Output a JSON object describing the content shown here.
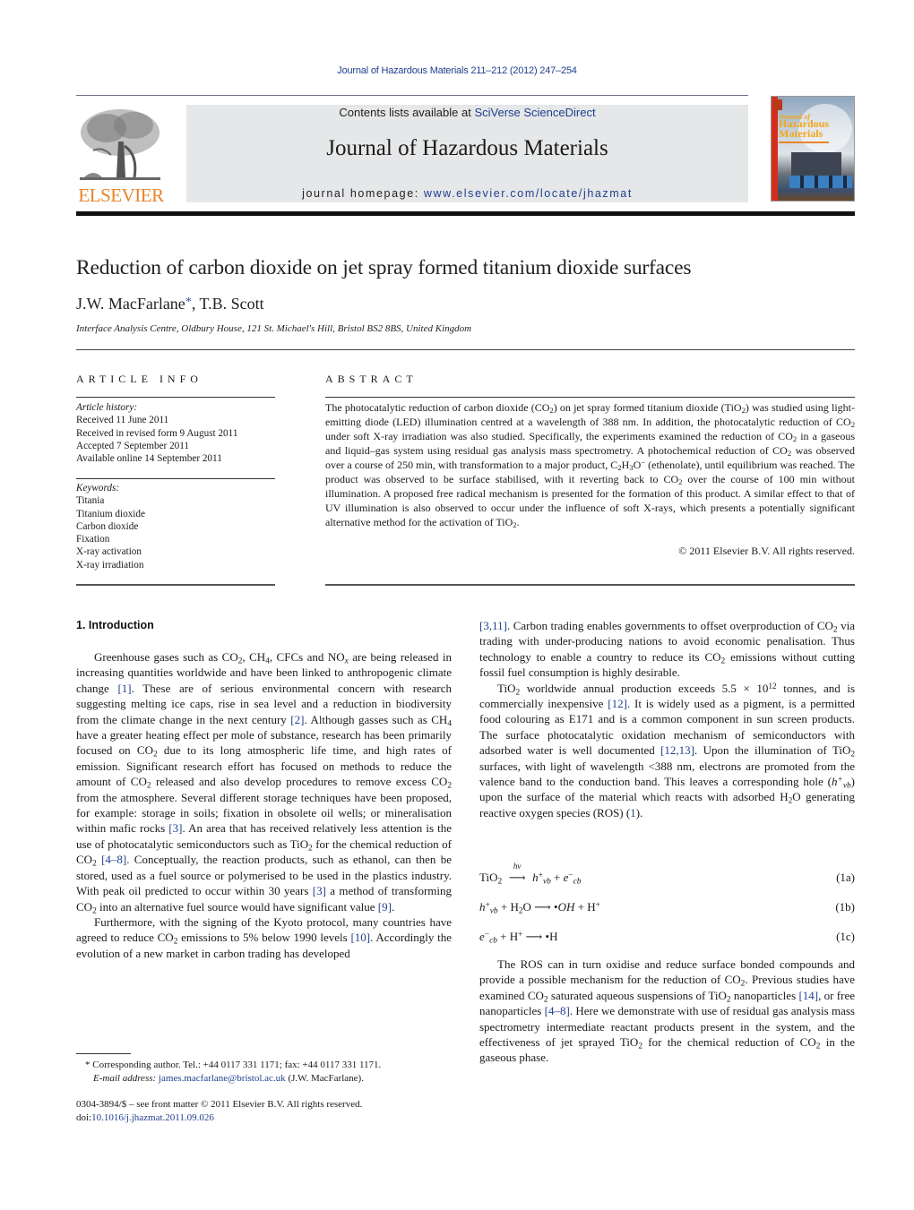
{
  "header": {
    "citation": "Journal of Hazardous Materials 211–212 (2012) 247–254",
    "contents_prefix": "Contents lists available at ",
    "contents_link": "SciVerse ScienceDirect",
    "journal_title": "Journal of Hazardous Materials",
    "homepage_prefix": "journal homepage: ",
    "homepage_link": "www.elsevier.com/locate/jhazmat",
    "publisher_wordmark": "ELSEVIER",
    "cover": {
      "line1": "Journal of",
      "line2": "Hazardous",
      "line3": "Materials"
    },
    "colors": {
      "link": "#1f3f8f",
      "elsevier_orange": "#e8842a",
      "masthead_bg": "#e6e7e8"
    }
  },
  "article": {
    "title": "Reduction of carbon dioxide on jet spray formed titanium dioxide surfaces",
    "authors": {
      "first": "J.W. MacFarlane",
      "marker": "*",
      "rest": ", T.B. Scott"
    },
    "affiliation": "Interface Analysis Centre, Oldbury House, 121 St. Michael's Hill, Bristol BS2 8BS, United Kingdom"
  },
  "article_info": {
    "heading": "ARTICLE INFO",
    "history_label": "Article history:",
    "history": [
      "Received 11 June 2011",
      "Received in revised form 9 August 2011",
      "Accepted 7 September 2011",
      "Available online 14 September 2011"
    ],
    "keywords_label": "Keywords:",
    "keywords": [
      "Titania",
      "Titanium dioxide",
      "Carbon dioxide",
      "Fixation",
      "X-ray activation",
      "X-ray irradiation"
    ]
  },
  "abstract": {
    "heading": "ABSTRACT",
    "segments": {
      "s1": "The photocatalytic reduction of carbon dioxide (CO",
      "s2": ") on jet spray formed titanium dioxide (TiO",
      "s3": ") was studied using light-emitting diode (LED) illumination centred at a wavelength of 388 nm. In addition, the photocatalytic reduction of CO",
      "s4": " under soft X-ray irradiation was also studied. Specifically, the experiments examined the reduction of CO",
      "s5": " in a gaseous and liquid–gas system using residual gas analysis mass spectrometry. A photochemical reduction of CO",
      "s6": " was observed over a course of 250 min, with transformation to a major product, C",
      "s7": "H",
      "s8": "O",
      "s9": " (ethenolate), until equilibrium was reached. The product was observed to be surface stabilised, with it reverting back to CO",
      "s10": " over the course of 100 min without illumination. A proposed free radical mechanism is presented for the formation of this product. A similar effect to that of UV illumination is also observed to occur under the influence of soft X-rays, which presents a potentially significant alternative method for the activation of TiO",
      "s11": "."
    },
    "copyright": "© 2011 Elsevier B.V. All rights reserved."
  },
  "introduction": {
    "heading": "1.  Introduction",
    "p1": {
      "a": "Greenhouse gases such as CO",
      "b": ", CH",
      "c": ", CFCs and NO",
      "d": " are being released in increasing quantities worldwide and have been linked to anthropogenic climate change ",
      "ref1": "[1]",
      "e": ". These are of serious environmental concern with research suggesting melting ice caps, rise in sea level and a reduction in biodiversity from the climate change in the next century ",
      "ref2": "[2]",
      "f": ". Although gasses such as CH",
      "g": " have a greater heating effect per mole of substance, research has been primarily focused on CO",
      "h": " due to its long atmospheric life time, and high rates of emission. Significant research effort has focused on methods to reduce the amount of CO",
      "i": " released and also develop procedures to remove excess CO",
      "j": " from the atmosphere. Several different storage techniques have been proposed, for example: storage in soils; fixation in obsolete oil wells; or mineralisation within mafic rocks ",
      "ref3": "[3]",
      "k": ". An area that has received relatively less attention is the use of photocatalytic semiconductors such as TiO",
      "l": " for the chemical reduction of CO",
      "ref4": "[4–8]",
      "m": ". Conceptually, the reaction products, such as ethanol, can then be stored, used as a fuel source or polymerised to be used in the plastics industry. With peak oil predicted to occur within 30 years ",
      "ref5": "[3]",
      "n": " a method of transforming CO",
      "o": " into an alternative fuel source would have significant value ",
      "ref6": "[9]",
      "p": "."
    },
    "p2": {
      "a": "Furthermore, with the signing of the Kyoto protocol, many countries have agreed to reduce CO",
      "b": " emissions to 5% below 1990 levels ",
      "ref1": "[10]",
      "c": ". Accordingly the evolution of a new market in carbon trading has developed ",
      "ref2": "[3,11]",
      "d": ". Carbon trading enables governments to offset overproduction of CO",
      "e": " via trading with under-producing nations to avoid economic penalisation. Thus technology to enable a country to reduce its CO",
      "f": " emissions without cutting fossil fuel consumption is highly desirable."
    },
    "p3": {
      "a": "TiO",
      "b": " worldwide annual production exceeds 5.5 × 10",
      "exp": "12",
      "c": " tonnes, and is commercially inexpensive ",
      "ref1": "[12]",
      "d": ". It is widely used as a pigment, is a permitted food colouring as E171 and is a common component in sun screen products. The surface photocatalytic oxidation mechanism of semiconductors with adsorbed water is well documented ",
      "ref2": "[12,13]",
      "e": ". Upon the illumination of TiO",
      "f": " surfaces, with light of wavelength <388 nm, electrons are promoted from the valence band to the conduction band. This leaves a corresponding hole (",
      "g": ") upon the surface of the material which reacts with adsorbed H",
      "h": "O generating reactive oxygen species (ROS) (",
      "ref3": "1",
      "i": ")."
    },
    "equations": [
      {
        "number": "(1a)"
      },
      {
        "number": "(1b)"
      },
      {
        "number": "(1c)"
      }
    ],
    "p4": {
      "a": "The ROS can in turn oxidise and reduce surface bonded compounds and provide a possible mechanism for the reduction of CO",
      "b": ". Previous studies have examined CO",
      "c": " saturated aqueous suspensions of TiO",
      "d": " nanoparticles ",
      "ref1": "[14]",
      "e": ", or free nanoparticles ",
      "ref2": "[4–8]",
      "f": ". Here we demonstrate with use of residual gas analysis mass spectrometry intermediate reactant products present in the system, and the effectiveness of jet sprayed TiO",
      "g": " for the chemical reduction of CO",
      "h": " in the gaseous phase."
    }
  },
  "footnote": {
    "marker": "*",
    "contact": " Corresponding author. Tel.: +44 0117 331 1171; fax: +44 0117 331 1171.",
    "email_label": "E-mail address:",
    "email": "james.macfarlane@bristol.ac.uk",
    "email_suffix": " (J.W. MacFarlane)."
  },
  "front_matter": {
    "issn_line": "0304-3894/$ – see front matter © 2011 Elsevier B.V. All rights reserved.",
    "doi_prefix": "doi:",
    "doi": "10.1016/j.jhazmat.2011.09.026"
  },
  "common": {
    "sub2": "2",
    "sub3": "3",
    "sub4": "4",
    "subx": "x",
    "minus": "−",
    "plus": "+"
  }
}
